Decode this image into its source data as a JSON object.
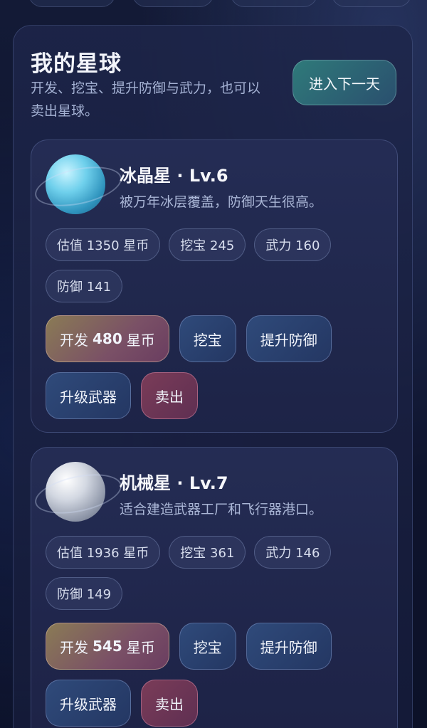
{
  "panel": {
    "title": "我的星球",
    "description": "开发、挖宝、提升防御与武力，也可以卖出星球。",
    "next_day_label": "进入下一天"
  },
  "colors": {
    "ice_planet": "#4fb7d8",
    "mech_planet": "#b8bfcc",
    "next_day_button": "#2f7a7a",
    "develop_button": "#8a7b55",
    "sell_button": "#7a3c58"
  },
  "planets": [
    {
      "name": "冰晶星 · Lv.6",
      "description": "被万年冰层覆盖，防御天生很高。",
      "stats": {
        "value": "估值 1350 星币",
        "treasure": "挖宝 245",
        "force": "武力 160",
        "defense": "防御 141"
      },
      "actions": {
        "develop_prefix": "开发",
        "develop_cost": "480",
        "develop_suffix": "星币",
        "treasure": "挖宝",
        "defense": "提升防御",
        "weapon": "升级武器",
        "sell": "卖出"
      }
    },
    {
      "name": "机械星 · Lv.7",
      "description": "适合建造武器工厂和飞行器港口。",
      "stats": {
        "value": "估值 1936 星币",
        "treasure": "挖宝 361",
        "force": "武力 146",
        "defense": "防御 149"
      },
      "actions": {
        "develop_prefix": "开发",
        "develop_cost": "545",
        "develop_suffix": "星币",
        "treasure": "挖宝",
        "defense": "提升防御",
        "weapon": "升级武器",
        "sell": "卖出"
      }
    }
  ]
}
